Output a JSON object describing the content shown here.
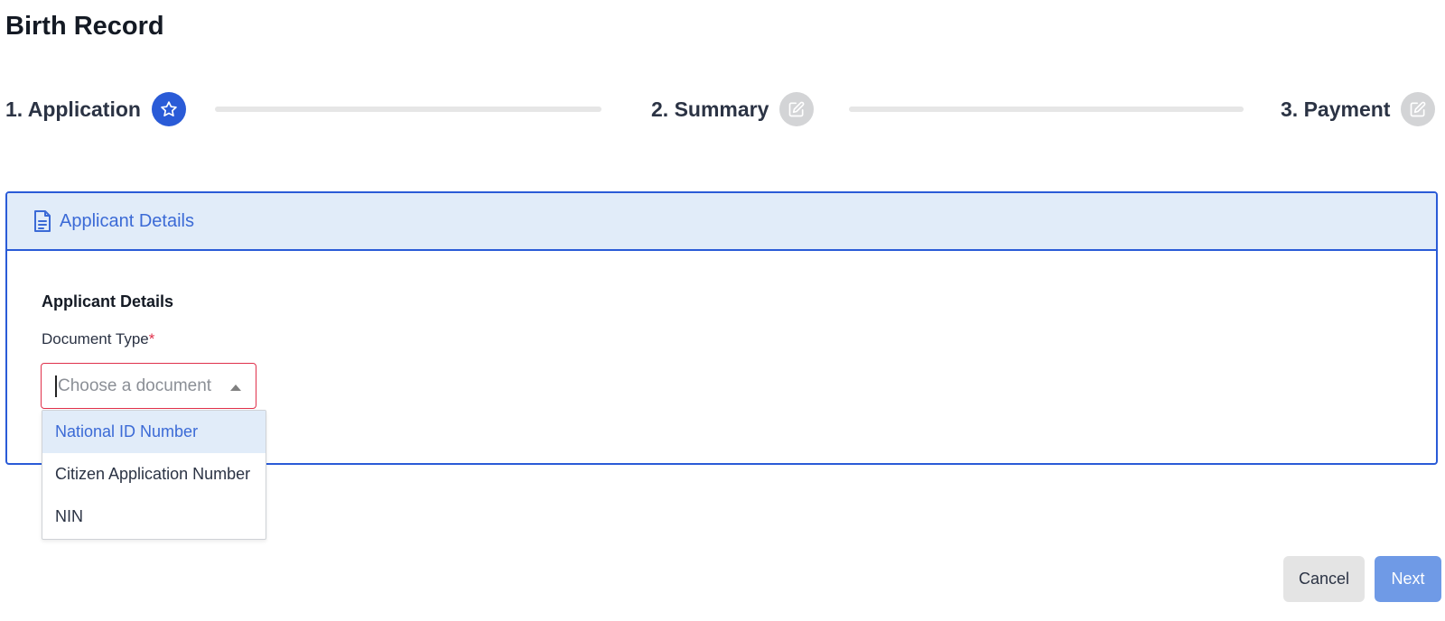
{
  "page": {
    "title": "Birth Record"
  },
  "stepper": {
    "steps": [
      {
        "label": "1. Application",
        "icon": "star-icon",
        "state": "active"
      },
      {
        "label": "2. Summary",
        "icon": "edit-icon",
        "state": "inactive"
      },
      {
        "label": "3. Payment",
        "icon": "edit-icon",
        "state": "inactive"
      }
    ]
  },
  "card": {
    "header_title": "Applicant Details",
    "header_icon": "document-icon",
    "section_title": "Applicant Details",
    "field": {
      "label": "Document Type",
      "required_mark": "*",
      "placeholder": "Choose a document",
      "options": [
        {
          "label": "National ID Number",
          "highlighted": true
        },
        {
          "label": "Citizen Application Number",
          "highlighted": false
        },
        {
          "label": "NIN",
          "highlighted": false
        }
      ]
    }
  },
  "actions": {
    "cancel_label": "Cancel",
    "next_label": "Next"
  },
  "colors": {
    "accent": "#2a5bd7",
    "header_bg": "#e1ecf9",
    "required": "#e0314b",
    "next_button": "#6f9ae6",
    "inactive_step": "#d3d4d6"
  }
}
